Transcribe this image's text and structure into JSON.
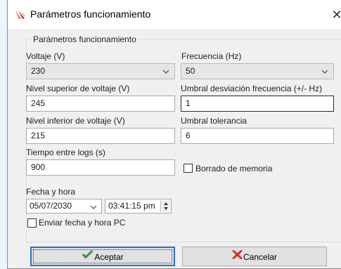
{
  "window": {
    "title": "Parámetros funcionamiento",
    "close": "✕"
  },
  "group": {
    "label": "Parámetros funcionamiento"
  },
  "fields": {
    "voltaje": {
      "label": "Voltaje (V)",
      "value": "230"
    },
    "frecuencia": {
      "label": "Frecuencia (Hz)",
      "value": "50"
    },
    "nivel_superior": {
      "label": "Nivel superior de voltaje (V)",
      "value": "245"
    },
    "umbral_desviacion": {
      "label": "Umbral desviación frecuencia (+/- Hz)",
      "value": "1"
    },
    "nivel_inferior": {
      "label": "Nivel inferior de voltaje (V)",
      "value": "215"
    },
    "umbral_tolerancia": {
      "label": "Umbral tolerancia",
      "value": "6"
    },
    "tiempo_logs": {
      "label": "Tiempo entre logs (s)",
      "value": "900"
    },
    "borrado_memoria": {
      "label": "Borrado de memoria",
      "checked": false
    },
    "fecha_hora": {
      "label": "Fecha y hora",
      "date": "05/07/2030",
      "time": "03:41:15 pm"
    },
    "enviar_fecha": {
      "label": "Enviar fecha y hora PC",
      "checked": false
    }
  },
  "buttons": {
    "aceptar": "Aceptar",
    "cancelar": "Cancelar"
  },
  "colors": {
    "accent": "#2a6fd0",
    "check_green": "#3aa23a",
    "cancel_red": "#d9342b",
    "app_icon_red": "#d9534f"
  },
  "icons": {
    "app": "app-icon",
    "close": "close-icon",
    "dropdown": "chevron-down-icon",
    "accept": "checkmark-icon",
    "cancel": "cross-icon"
  }
}
